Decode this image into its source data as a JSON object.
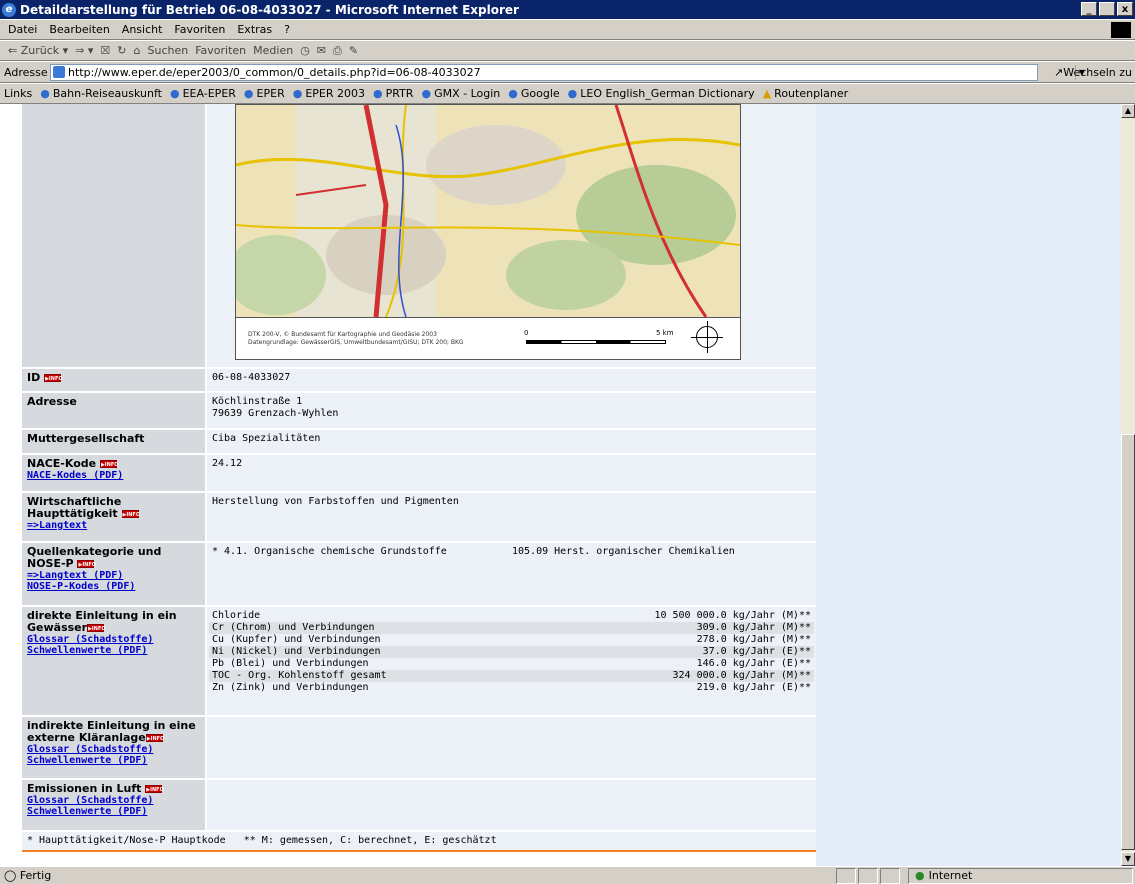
{
  "window": {
    "title": "Detaildarstellung für Betrieb 06-08-4033027 - Microsoft Internet Explorer",
    "buttons": [
      "_",
      " ",
      "x"
    ]
  },
  "menu": [
    "Datei",
    "Bearbeiten",
    "Ansicht",
    "Favoriten",
    "Extras",
    "?"
  ],
  "toolbar": {
    "back": "⇐ Zurück ▾",
    "forward": "⇒ ▾",
    "search": "Suchen",
    "favorites": "Favoriten",
    "media": "Medien"
  },
  "address": {
    "label": "Adresse",
    "url": "http://www.eper.de/eper2003/0_common/0_details.php?id=06-08-4033027",
    "go": "Wechseln zu"
  },
  "links": {
    "label": "Links",
    "items": [
      "Bahn-Reiseauskunft",
      "EEA-EPER",
      "EPER",
      "EPER 2003",
      "PRTR",
      "GMX - Login",
      "Google",
      "LEO English_German Dictionary",
      "Routenplaner"
    ]
  },
  "map": {
    "credit1": "DTK 200-V, © Bundesamt für Kartographie und Geodäsie 2003",
    "credit2": "Datengrundlage: GewässerGIS, Umweltbundesamt/GISU; DTK 200; BKG",
    "scale_start": "0",
    "scale_end": "5 km"
  },
  "info_badge": "▶INFO",
  "details": {
    "id": {
      "label": "ID",
      "value": "06-08-4033027"
    },
    "address": {
      "label": "Adresse",
      "line1": "Köchlinstraße 1",
      "line2": "79639 Grenzach-Wyhlen"
    },
    "parent": {
      "label": "Muttergesellschaft",
      "value": "Ciba Spezialitäten"
    },
    "nace": {
      "label": "NACE-Kode",
      "link": "NACE-Kodes (PDF)",
      "value": "24.12"
    },
    "activity": {
      "label1": "Wirtschaftliche",
      "label2": "Haupttätigkeit",
      "link": "=>Langtext",
      "value": "Herstellung von Farbstoffen und Pigmenten"
    },
    "source": {
      "label1": "Quellenkategorie und",
      "label2": "NOSE-P",
      "link1": "=>Langtext (PDF)",
      "link2": "NOSE-P-Kodes (PDF)",
      "cat": "* 4.1. Organische chemische Grundstoffe",
      "nose": "105.09 Herst. organischer Chemikalien"
    },
    "direct": {
      "label1": "direkte Einleitung in ein",
      "label2": "Gewässer",
      "link1": "Glossar (Schadstoffe)",
      "link2": "Schwellenwerte (PDF)",
      "rows": [
        {
          "name": "Chloride",
          "amount": "10 500 000.0 kg/Jahr (M)**"
        },
        {
          "name": "Cr (Chrom) und Verbindungen",
          "amount": "309.0 kg/Jahr (M)**"
        },
        {
          "name": "Cu (Kupfer) und Verbindungen",
          "amount": "278.0 kg/Jahr (M)**"
        },
        {
          "name": "Ni (Nickel) und Verbindungen",
          "amount": "37.0 kg/Jahr (E)**"
        },
        {
          "name": "Pb (Blei) und Verbindungen",
          "amount": "146.0 kg/Jahr (E)**"
        },
        {
          "name": "TOC - Org. Kohlenstoff gesamt",
          "amount": "324 000.0 kg/Jahr (M)**"
        },
        {
          "name": "Zn (Zink) und Verbindungen",
          "amount": "219.0 kg/Jahr (E)**"
        }
      ]
    },
    "indirect": {
      "label1": "indirekte Einleitung in eine",
      "label2": "externe Kläranlage",
      "link1": "Glossar (Schadstoffe)",
      "link2": "Schwellenwerte (PDF)"
    },
    "air": {
      "label": "Emissionen in Luft",
      "link1": "Glossar (Schadstoffe)",
      "link2": "Schwellenwerte (PDF)"
    }
  },
  "footnote": "* Haupttätigkeit/Nose-P Hauptkode   ** M: gemessen, C: berechnet, E: geschätzt",
  "status": {
    "text": "Fertig",
    "zone": "Internet"
  }
}
